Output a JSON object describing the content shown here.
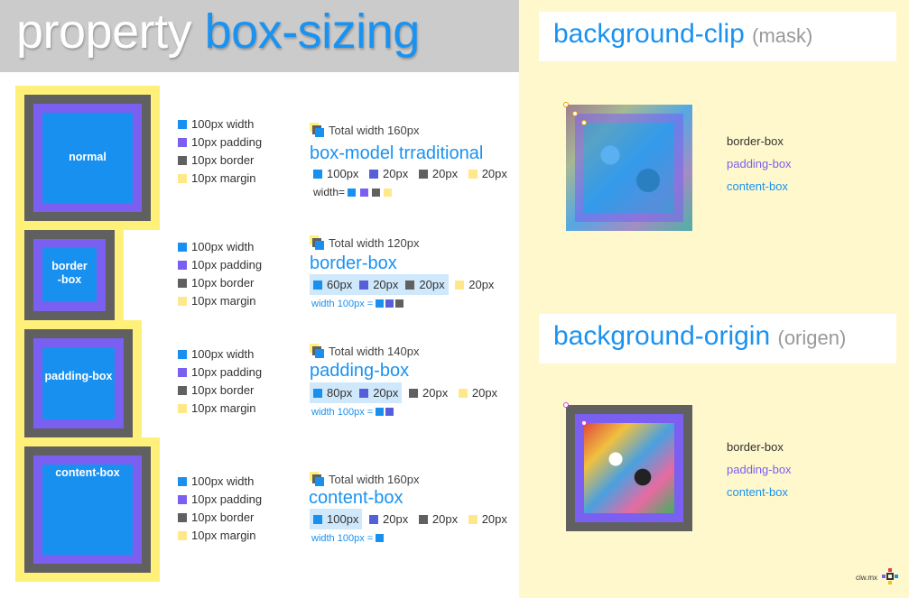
{
  "header": {
    "title_word1": "property",
    "title_word2": "box-sizing"
  },
  "right": {
    "clip": {
      "title": "background-clip",
      "sub": "(mask)"
    },
    "origin": {
      "title": "background-origin",
      "sub": "(origen)"
    },
    "labels": {
      "border": "border-box",
      "padding": "padding-box",
      "content": "content-box"
    },
    "credit": "ciw.mx"
  },
  "legend": {
    "width": "100px width",
    "padding": "10px padding",
    "border": "10px border",
    "margin": "10px margin"
  },
  "colors": {
    "content": "#1890f0",
    "padding": "#7b5ff0",
    "border": "#606060",
    "margin": "#fff07a",
    "title_blue": "#1a92f0"
  },
  "rows": [
    {
      "box_label_a": "normal",
      "box_label_b": "",
      "total": "Total width 160px",
      "model": "box-model trraditional",
      "v1": "100px",
      "v2": "20px",
      "v3": "20px",
      "v4": "20px",
      "formula": "width="
    },
    {
      "box_label_a": "border",
      "box_label_b": "-box",
      "total": "Total width 120px",
      "model": "border-box",
      "v1": "60px",
      "v2": "20px",
      "v3": "20px",
      "v4": "20px",
      "formula": "width 100px ="
    },
    {
      "box_label_a": "padding-box",
      "box_label_b": "",
      "total": "Total width 140px",
      "model": "padding-box",
      "v1": "80px",
      "v2": "20px",
      "v3": "20px",
      "v4": "20px",
      "formula": "width 100px ="
    },
    {
      "box_label_a": "content-box",
      "box_label_b": "",
      "total": "Total width 160px",
      "model": "content-box",
      "v1": "100px",
      "v2": "20px",
      "v3": "20px",
      "v4": "20px",
      "formula": "width 100px ="
    }
  ]
}
